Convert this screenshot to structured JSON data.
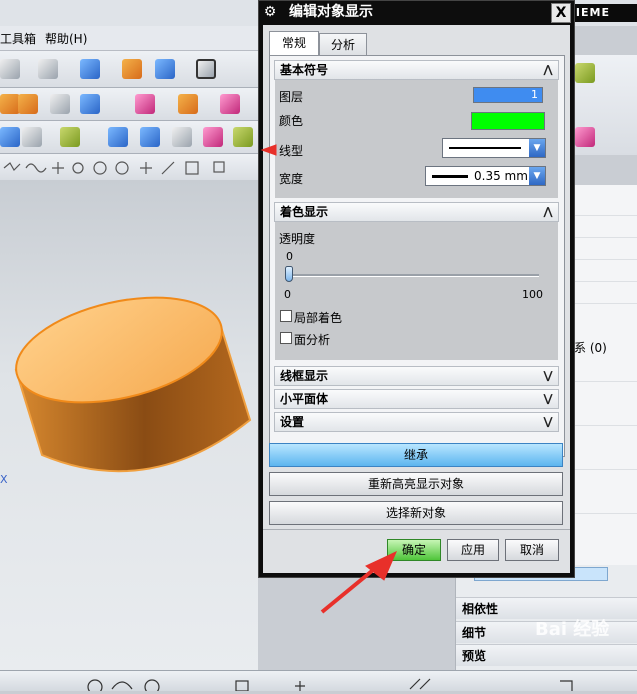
{
  "app": {
    "brand": "SIEME",
    "menu": [
      "工具箱",
      "帮助(H)"
    ],
    "coord_axis": "X",
    "right_panel_item": "系 (0)"
  },
  "side_panel": {
    "rows": [
      "相依性",
      "细节",
      "预览"
    ]
  },
  "watermark": "Bai 经验",
  "dialog": {
    "title": "编辑对象显示",
    "close": "X",
    "tabs": [
      {
        "label": "常规",
        "active": true
      },
      {
        "label": "分析",
        "active": false
      }
    ],
    "sections": {
      "basic": {
        "title": "基本符号",
        "layer_label": "图层",
        "layer_value": "1",
        "color_label": "颜色",
        "color": "#00ff00",
        "linetype_label": "线型",
        "width_label": "宽度",
        "width_value": "0.35 mm"
      },
      "shading": {
        "title": "着色显示",
        "transparency_label": "透明度",
        "transparency_value": "0",
        "slider_min": "0",
        "slider_max": "100",
        "transparency_fraction": 0,
        "partial_shading_label": "局部着色",
        "face_analysis_label": "面分析"
      },
      "wireframe": {
        "title": "线框显示"
      },
      "facet": {
        "title": "小平面体"
      },
      "settings": {
        "title": "设置"
      }
    },
    "buttons": {
      "inherit": "继承",
      "rehighlight": "重新高亮显示对象",
      "select_new": "选择新对象",
      "ok": "确定",
      "apply": "应用",
      "cancel": "取消"
    }
  },
  "colors": {
    "accent": "#3f8cf0",
    "ok_green": "#4fc53a",
    "cylinder": "#f2a040",
    "arrow": "#e8302a"
  }
}
